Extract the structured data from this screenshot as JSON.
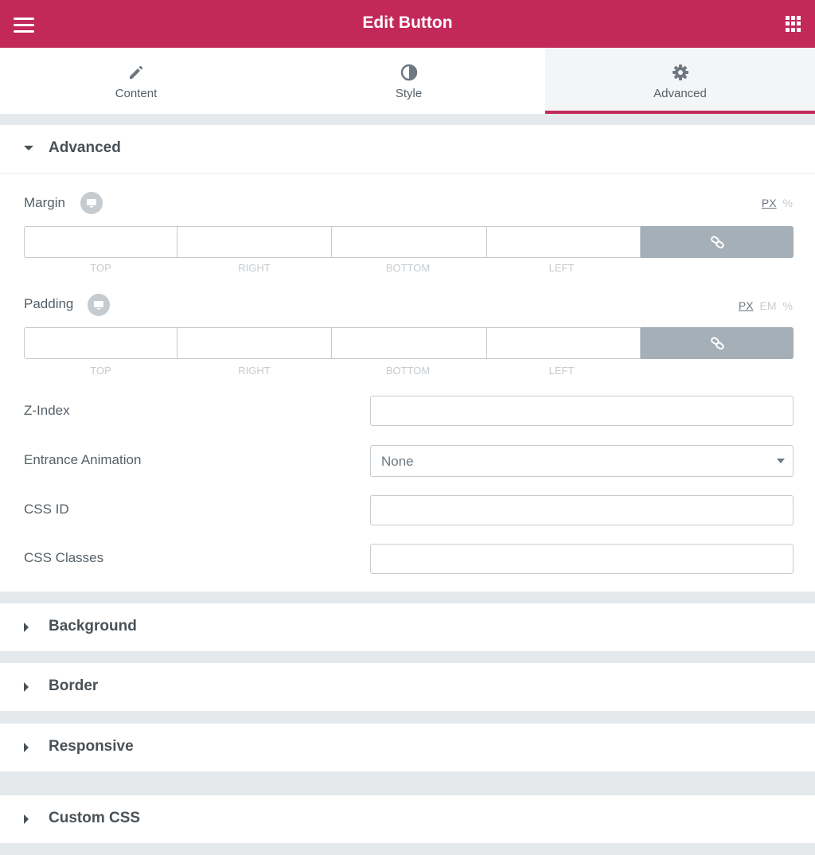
{
  "header": {
    "title": "Edit Button",
    "menu_icon": "hamburger-menu-icon",
    "apps_icon": "grid-apps-icon"
  },
  "tabs": [
    {
      "label": "Content",
      "icon": "pencil-icon"
    },
    {
      "label": "Style",
      "icon": "half-circle-icon"
    },
    {
      "label": "Advanced",
      "icon": "gear-icon",
      "active": true
    }
  ],
  "advanced": {
    "title": "Advanced",
    "margin": {
      "label": "Margin",
      "units": [
        "PX",
        "%"
      ],
      "active_unit": "PX",
      "sides": [
        "TOP",
        "RIGHT",
        "BOTTOM",
        "LEFT"
      ],
      "values": [
        "",
        "",
        "",
        ""
      ]
    },
    "padding": {
      "label": "Padding",
      "units": [
        "PX",
        "EM",
        "%"
      ],
      "active_unit": "PX",
      "sides": [
        "TOP",
        "RIGHT",
        "BOTTOM",
        "LEFT"
      ],
      "values": [
        "",
        "",
        "",
        ""
      ]
    },
    "z_index": {
      "label": "Z-Index",
      "value": ""
    },
    "entrance_animation": {
      "label": "Entrance Animation",
      "value": "None"
    },
    "css_id": {
      "label": "CSS ID",
      "value": ""
    },
    "css_classes": {
      "label": "CSS Classes",
      "value": ""
    }
  },
  "sections": [
    {
      "title": "Background"
    },
    {
      "title": "Border"
    },
    {
      "title": "Responsive"
    },
    {
      "title": "Custom CSS"
    }
  ],
  "colors": {
    "brand": "#c2295a",
    "panel_bg": "#e6e9ec",
    "link_button": "#a4afb7"
  }
}
